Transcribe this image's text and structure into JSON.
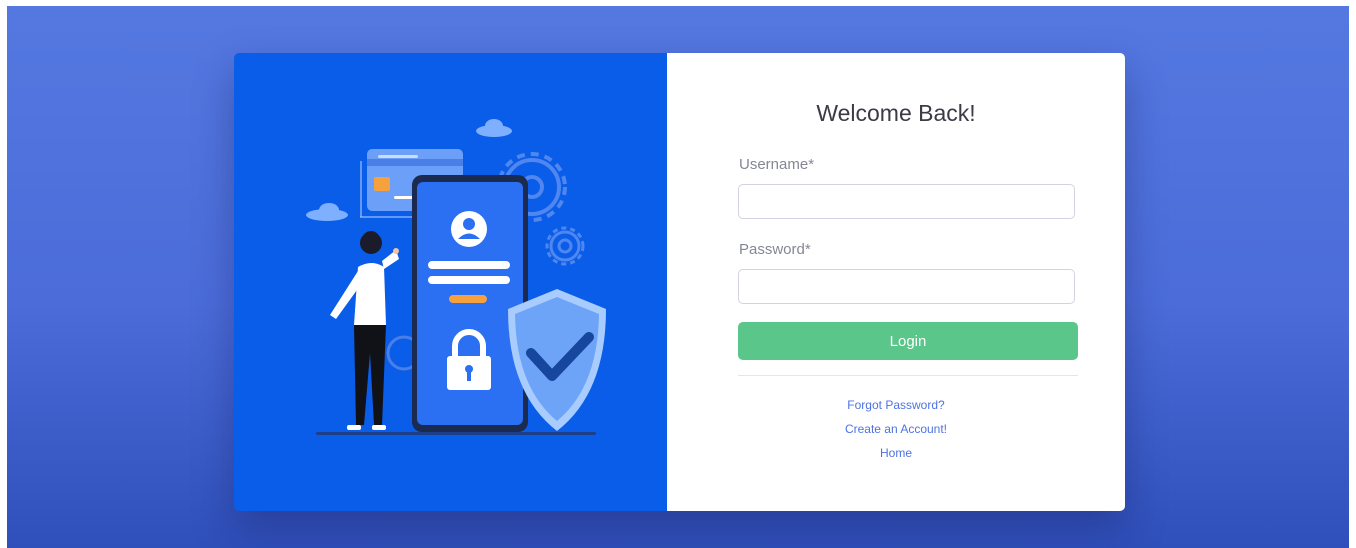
{
  "login": {
    "title": "Welcome Back!",
    "username_label": "Username*",
    "username_value": "",
    "password_label": "Password*",
    "password_value": "",
    "login_button": "Login"
  },
  "links": {
    "forgot_password": "Forgot Password?",
    "create_account": "Create an Account!",
    "home": "Home"
  },
  "illustration": {
    "icons": [
      "cloud-icon",
      "credit-card-icon",
      "gear-icon",
      "user-icon",
      "lock-icon",
      "shield-check-icon"
    ]
  },
  "colors": {
    "background": "#4b6cd9",
    "illustration_panel": "#0a5de8",
    "login_button": "#5ac689",
    "link": "#4e73df"
  }
}
